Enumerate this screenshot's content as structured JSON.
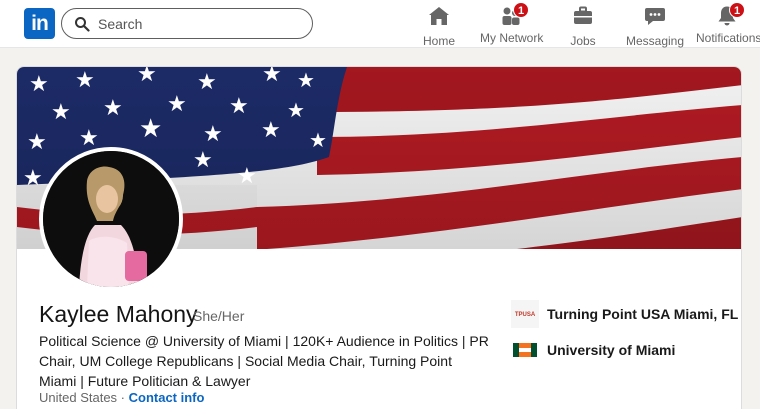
{
  "nav": {
    "logo_text": "in",
    "search_placeholder": "Search",
    "items": [
      {
        "label": "Home",
        "icon": "home-icon",
        "badge": ""
      },
      {
        "label": "My Network",
        "icon": "network-icon",
        "badge": "1"
      },
      {
        "label": "Jobs",
        "icon": "briefcase-icon",
        "badge": ""
      },
      {
        "label": "Messaging",
        "icon": "messaging-icon",
        "badge": ""
      },
      {
        "label": "Notifications",
        "icon": "bell-icon",
        "badge": "1"
      }
    ]
  },
  "profile": {
    "name": "Kaylee Mahony",
    "pronouns": "She/Her",
    "headline": "Political Science @ University of Miami | 120K+ Audience in Politics | PR Chair, UM College Republicans | Social Media Chair, Turning Point Miami | Future Politician & Lawyer",
    "location": "United States",
    "separator": " · ",
    "contact_label": "Contact info",
    "banner_image": "american-flag-banner",
    "organizations": [
      {
        "name": "Turning Point USA Miami, FL",
        "logo": "turning-point-logo"
      },
      {
        "name": "University of Miami",
        "logo": "university-of-miami-logo"
      }
    ]
  },
  "colors": {
    "brand": "#0a66c2",
    "badge": "#cc1016",
    "page_bg": "#f3f2ef"
  }
}
